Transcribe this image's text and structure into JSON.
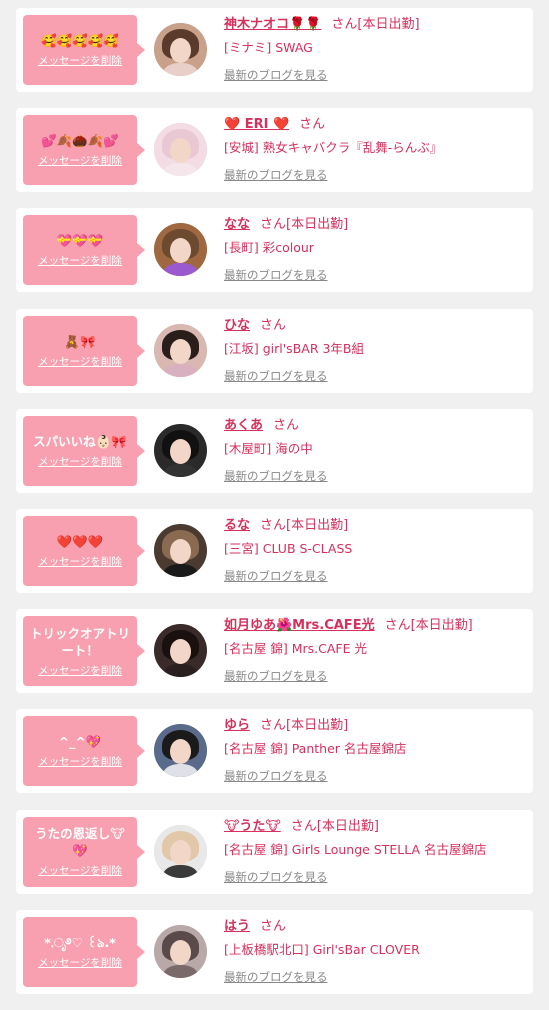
{
  "delete_label": "メッセージを削除",
  "san_label": "さん",
  "blog_label": "最新のブログを見る",
  "cards": [
    {
      "message": "🥰🥰🥰🥰🥰",
      "name": "神木ナオコ🌹🌹",
      "today": "[本日出勤]",
      "shop": "[ミナミ] SWAG",
      "avatar": {
        "bg": "#c9a08a",
        "hair": "#5a3a2a",
        "body": "#e8d0c8"
      }
    },
    {
      "message": "💕🍂🌰🍂💕",
      "name": "❤️ ERI ❤️",
      "today": "",
      "shop": "[安城] 熟女キャバクラ『乱舞-らんぶ』",
      "avatar": {
        "bg": "#f3dce4",
        "hair": "#e9c7d3",
        "body": "#f5e6ec"
      }
    },
    {
      "message": "💝💝💝",
      "name": "なな",
      "today": "[本日出勤]",
      "shop": "[長町] 彩colour",
      "avatar": {
        "bg": "#a06840",
        "hair": "#6b4a30",
        "body": "#9b59d0"
      }
    },
    {
      "message": "🧸🎀",
      "name": "ひな",
      "today": "",
      "shop": "[江坂] girl'sBAR 3年B組",
      "avatar": {
        "bg": "#d8b8b0",
        "hair": "#2a1e1a",
        "body": "#d8b0c0"
      }
    },
    {
      "message": "スパいいね👶🏻🎀",
      "name": "あくあ",
      "today": "",
      "shop": "[木屋町] 海の中",
      "avatar": {
        "bg": "#2a2a2a",
        "hair": "#111111",
        "body": "#333333"
      }
    },
    {
      "message": "❤️❤️❤️",
      "name": "るな",
      "today": "[本日出勤]",
      "shop": "[三宮] CLUB S-CLASS",
      "avatar": {
        "bg": "#4a3a30",
        "hair": "#8a6a50",
        "body": "#1a1a1a"
      }
    },
    {
      "message": "トリックオアトリート！",
      "name": "如月ゆあ🌺Mrs.CAFE光",
      "today": "[本日出勤]",
      "shop": "[名古屋 錦] Mrs.CAFE 光",
      "avatar": {
        "bg": "#3a2a2a",
        "hair": "#1a1010",
        "body": "#2a2020"
      }
    },
    {
      "message": "^_^💖",
      "name": "ゆら",
      "today": "[本日出勤]",
      "shop": "[名古屋 錦] Panther 名古屋錦店",
      "avatar": {
        "bg": "#5a6a8a",
        "hair": "#1a1a1a",
        "body": "#e0e0e8"
      }
    },
    {
      "message": "うたの恩返し🐮💖",
      "name": "🐮うた🐮",
      "today": "[本日出勤]",
      "shop": "[名古屋 錦] Girls Lounge STELLA 名古屋錦店",
      "avatar": {
        "bg": "#e8e8e8",
        "hair": "#e0c8a8",
        "body": "#3a3a3a"
      }
    },
    {
      "message": "*.ೃ࿔♡ ꒰ঌ.*",
      "name": "はう",
      "today": "",
      "shop": "[上板橋駅北口] Girl'sBar CLOVER",
      "avatar": {
        "bg": "#b8a8a8",
        "hair": "#5a4a4a",
        "body": "#7a6a6a"
      }
    }
  ]
}
